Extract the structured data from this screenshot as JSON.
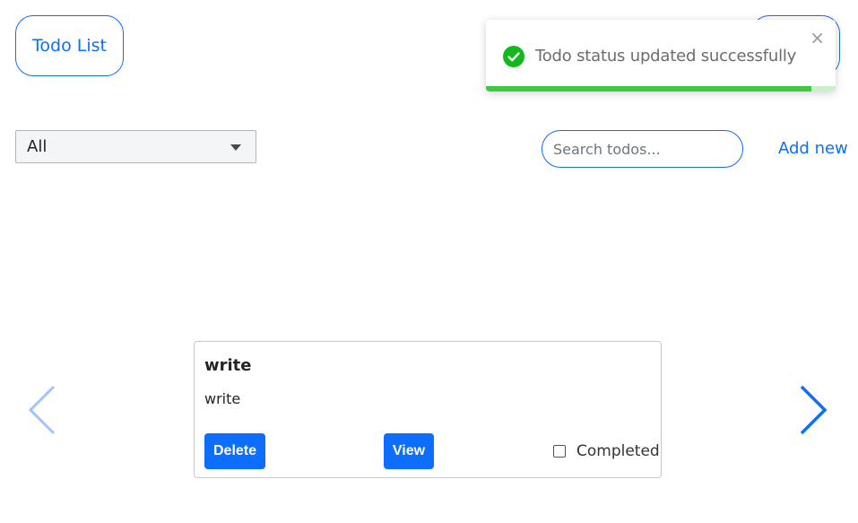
{
  "header": {
    "todo_list_label": "Todo List",
    "right_button_label": ""
  },
  "toast": {
    "message": "Todo status updated successfully",
    "close_symbol": "×",
    "icon": "check-circle-icon",
    "progress": 0.93,
    "colors": {
      "success": "#11b91d",
      "progress": "#3ec93f"
    }
  },
  "filter": {
    "selected": "All"
  },
  "search": {
    "placeholder": "Search todos...",
    "value": ""
  },
  "add_new_label": "Add new",
  "carousel": {
    "prev_icon": "chevron-left-icon",
    "next_icon": "chevron-right-icon"
  },
  "card": {
    "title": "write",
    "description": "write",
    "delete_label": "Delete",
    "view_label": "View",
    "completed_label": "Completed",
    "completed": false
  },
  "colors": {
    "accent": "#0d6efd",
    "arrow_disabled": "#9ec5fe"
  }
}
